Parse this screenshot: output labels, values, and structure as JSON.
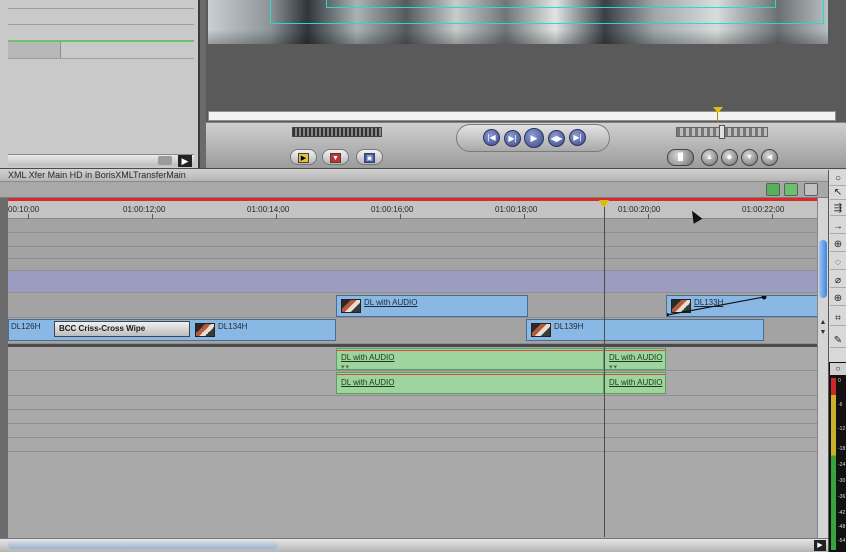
{
  "timeline": {
    "title": "XML Xfer Main HD in BorisXMLTransferMain",
    "ruler_labels": [
      "00:10;00",
      "01:00:12;00",
      "01:00:14;00",
      "01:00:16;00",
      "01:00:18;00",
      "01:00:20;00",
      "01:00:22;00"
    ],
    "clips": {
      "v2_dl_audio": "DL with AUDIO",
      "v2_dl133": "DL133H",
      "v1_dl126": "DL126H",
      "v1_transition": "BCC Criss-Cross Wipe",
      "v1_dl134": "DL134H",
      "v1_dl139": "DL139H",
      "a1_main": "DL with AUDIO",
      "a2_main": "DL with AUDIO",
      "a1_tail": "DL with AUDIO",
      "a2_tail": "DL with AUDIO"
    }
  },
  "meter": {
    "scale": [
      "0",
      "-6",
      "-12",
      "-18",
      "-24",
      "-30",
      "-36",
      "-42",
      "-48",
      "-54"
    ]
  },
  "colors": {
    "video_clip": "#8ab8e4",
    "audio_clip": "#9ed49e",
    "playhead": "#e0bb00",
    "in_out_bar": "#d72a2a",
    "overlay_track": "#9c9bc0"
  },
  "icons": {
    "tools": [
      "arrow-tool-icon",
      "track-select-icon",
      "ripple-tool-icon",
      "roll-tool-icon",
      "razor-tool-icon",
      "slip-tool-icon",
      "pen-tool-icon",
      "zoom-tool-icon",
      "crop-tool-icon",
      "pen-pencil-icon"
    ],
    "transport": [
      "go-to-previous-edit-icon",
      "play-in-to-out-icon",
      "play-icon",
      "play-around-icon",
      "go-to-next-edit-icon"
    ]
  }
}
